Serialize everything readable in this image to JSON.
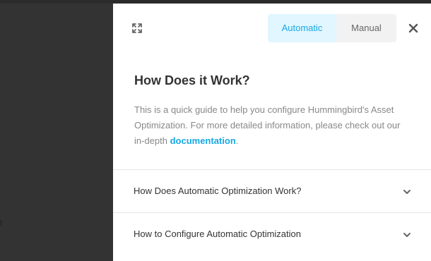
{
  "modal": {
    "expand_icon": "expand-icon",
    "close_icon": "close-icon",
    "tabs": [
      {
        "label": "Automatic",
        "active": true
      },
      {
        "label": "Manual",
        "active": false
      }
    ],
    "title": "How Does it Work?",
    "description": {
      "text_before": "This is a quick guide to help you configure Hummingbird's Asset Optimization. For more detailed information, please check out our in-depth ",
      "link_text": "documentation",
      "text_after": "."
    },
    "accordion": [
      {
        "label": "How Does Automatic Optimization Work?",
        "icon": "chevron-down-icon"
      },
      {
        "label": "How to Configure Automatic Optimization",
        "icon": "chevron-down-icon"
      }
    ]
  },
  "colors": {
    "backdrop": "#333333",
    "accent": "#17a8e3",
    "active_tab_bg": "#e1f6ff",
    "inactive_tab_bg": "#f2f2f2"
  }
}
